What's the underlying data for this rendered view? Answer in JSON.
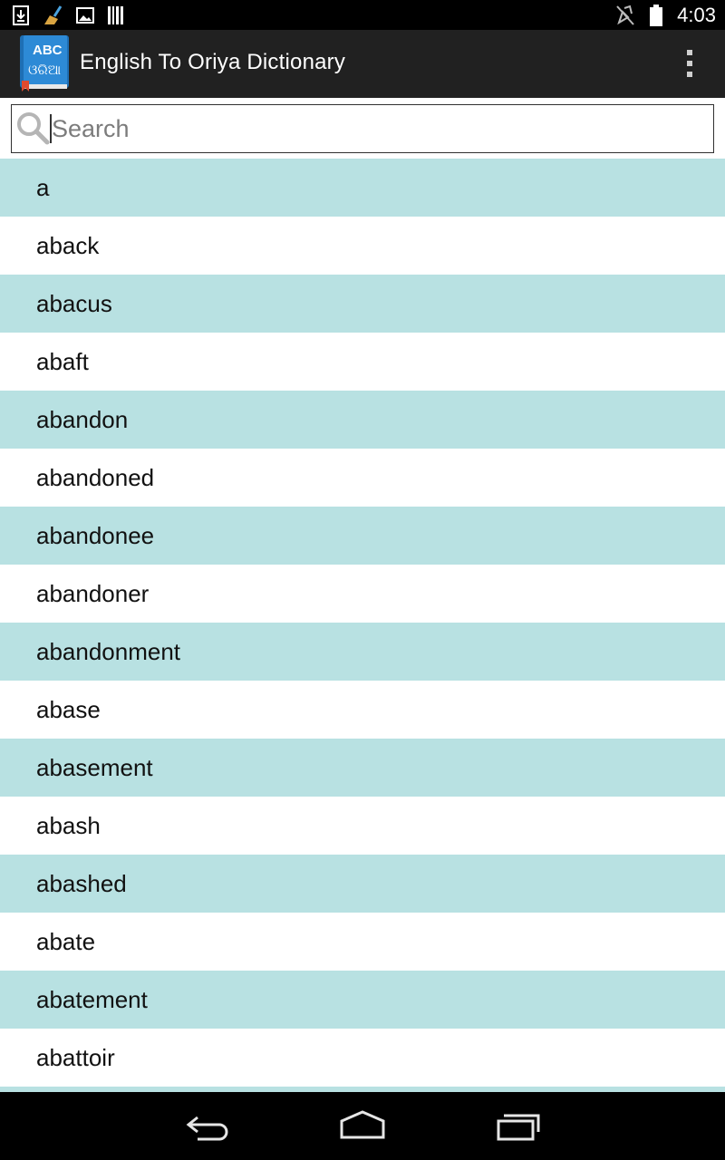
{
  "status_bar": {
    "time": "4:03",
    "left_icons": [
      "download-icon",
      "cleaner-icon",
      "image-icon",
      "barcode-icon"
    ],
    "right_icons": [
      "muted-icon",
      "battery-icon"
    ]
  },
  "action_bar": {
    "app_title": "English To Oriya Dictionary",
    "logo_text": "ABC",
    "logo_subtext": "ଓରିଆ"
  },
  "search": {
    "placeholder": "Search",
    "value": ""
  },
  "words": [
    "a",
    "aback",
    "abacus",
    "abaft",
    "abandon",
    "abandoned",
    "abandonee",
    "abandoner",
    "abandonment",
    "abase",
    "abasement",
    "abash",
    "abashed",
    "abate",
    "abatement",
    "abattoir",
    ""
  ],
  "nav_bar": {
    "buttons": [
      "back-icon",
      "home-icon",
      "recents-icon"
    ]
  },
  "colors": {
    "row_alt": "#b8e1e2",
    "action_bar": "#212121",
    "logo_blue": "#2d8ad6"
  }
}
